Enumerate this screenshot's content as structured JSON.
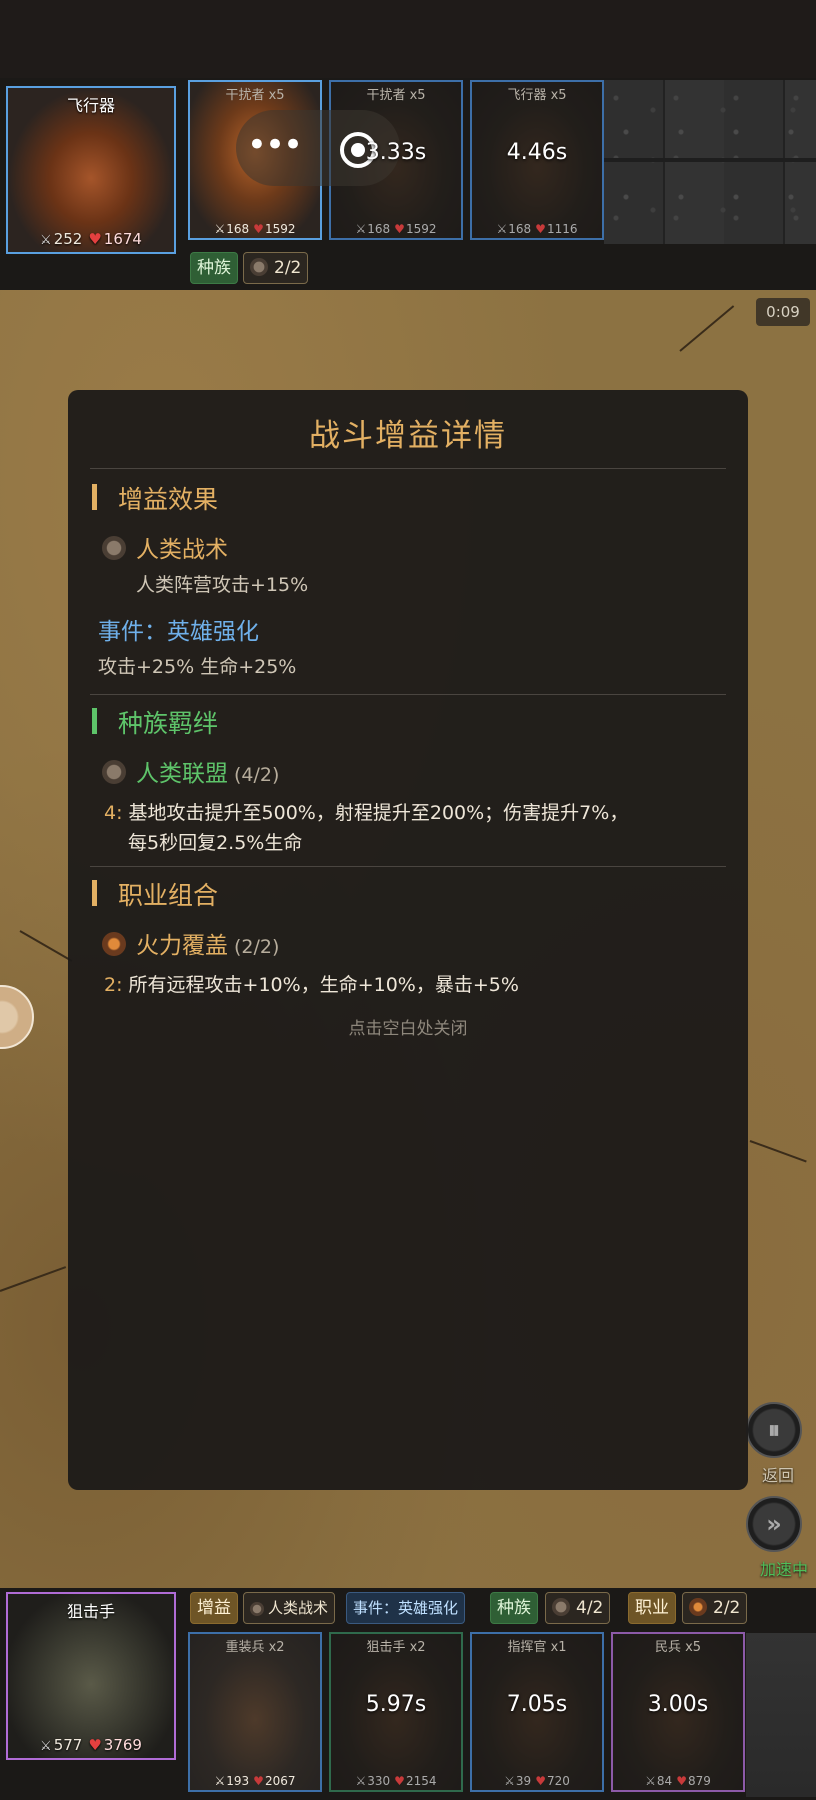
{
  "enemy": {
    "hero": {
      "name": "飞行器",
      "atk": "252",
      "hp": "1674"
    },
    "units": [
      {
        "title": "干扰者 x5",
        "timer": "",
        "atk": "168",
        "hp": "1592"
      },
      {
        "title": "干扰者 x5",
        "timer": "3.33s",
        "atk": "168",
        "hp": "1592"
      },
      {
        "title": "飞行器 x5",
        "timer": "4.46s",
        "atk": "168",
        "hp": "1116"
      }
    ],
    "tags": {
      "race_label": "种族",
      "race_value": "2/2"
    }
  },
  "overlay": {
    "more_icon": "more-dots-icon",
    "target_icon": "target-icon"
  },
  "battle": {
    "clock": "0:09",
    "back_label": "返回",
    "speed_label": "加速中"
  },
  "modal": {
    "title": "战斗增益详情",
    "sections": {
      "buffs": {
        "heading": "增益效果",
        "item_name": "人类战术",
        "item_desc": "人类阵营攻击+15%",
        "event_title": "事件：英雄强化",
        "event_desc": "攻击+25% 生命+25%"
      },
      "race": {
        "heading": "种族羁绊",
        "item_name": "人类联盟",
        "item_count": "(4/2)",
        "level": "4:",
        "desc_line1": "基地攻击提升至500%，射程提升至200%；伤害提升7%，",
        "desc_line2": "每5秒回复2.5%生命"
      },
      "job": {
        "heading": "职业组合",
        "item_name": "火力覆盖",
        "item_count": "(2/2)",
        "level": "2:",
        "desc_line1": "所有远程攻击+10%，生命+10%，暴击+5%"
      }
    },
    "close_hint": "点击空白处关闭"
  },
  "player": {
    "hero": {
      "name": "狙击手",
      "atk": "577",
      "hp": "3769"
    },
    "tags": {
      "buff_label": "增益",
      "buff_item": "人类战术",
      "event_item": "事件：英雄强化",
      "race_label": "种族",
      "race_value": "4/2",
      "job_label": "职业",
      "job_value": "2/2"
    },
    "units": [
      {
        "title": "重装兵 x2",
        "timer": "",
        "atk": "193",
        "hp": "2067"
      },
      {
        "title": "狙击手 x2",
        "timer": "5.97s",
        "atk": "330",
        "hp": "2154"
      },
      {
        "title": "指挥官 x1",
        "timer": "7.05s",
        "atk": "39",
        "hp": "720"
      },
      {
        "title": "民兵 x5",
        "timer": "3.00s",
        "atk": "84",
        "hp": "879"
      }
    ]
  },
  "colors": {
    "gold": "#e3b063",
    "green": "#5ec46a",
    "blue": "#6fb0ea",
    "panel": "#1c1a18"
  }
}
